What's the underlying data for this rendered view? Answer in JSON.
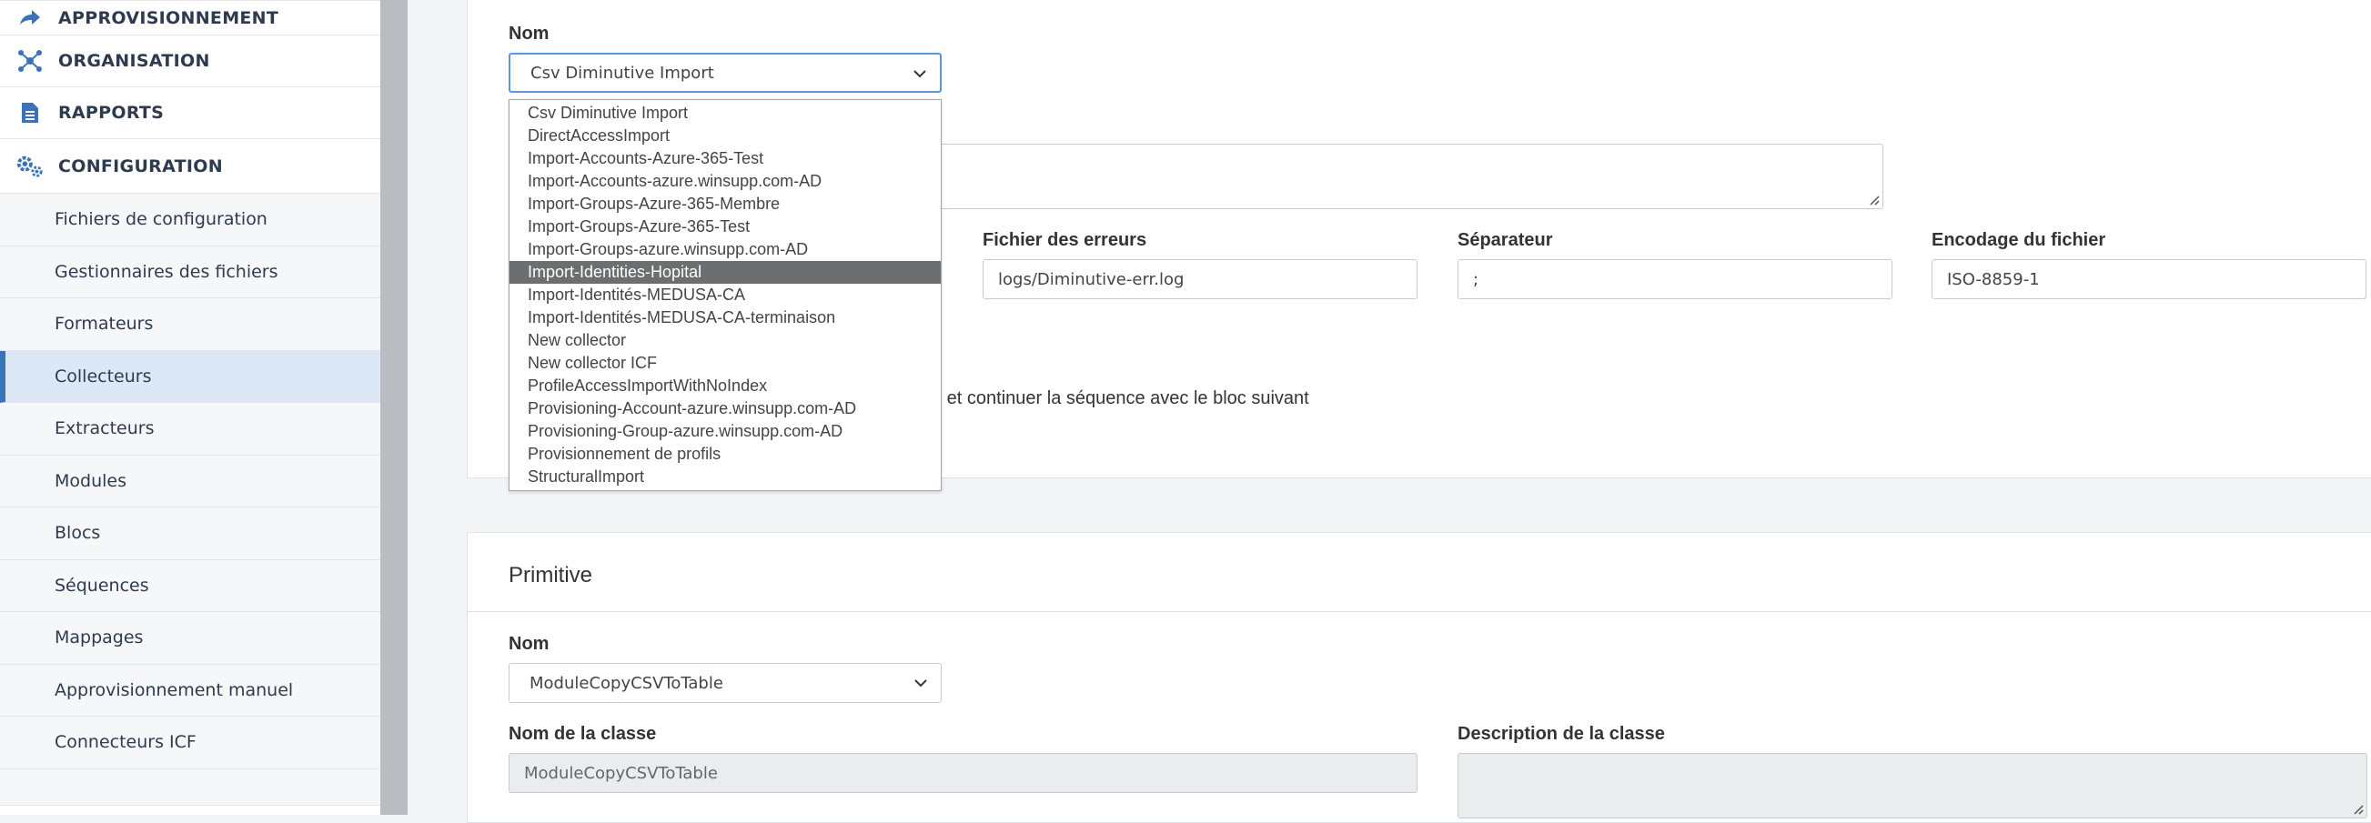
{
  "sidebar": {
    "top_items": [
      {
        "label": "APPROVISIONNEMENT",
        "icon": "share-arrow-icon"
      },
      {
        "label": "ORGANISATION",
        "icon": "network-icon"
      },
      {
        "label": "RAPPORTS",
        "icon": "document-icon"
      },
      {
        "label": "CONFIGURATION",
        "icon": "gears-icon"
      }
    ],
    "sub_items": [
      {
        "label": "Fichiers de configuration",
        "active": false
      },
      {
        "label": "Gestionnaires des fichiers",
        "active": false
      },
      {
        "label": "Formateurs",
        "active": false
      },
      {
        "label": "Collecteurs",
        "active": true
      },
      {
        "label": "Extracteurs",
        "active": false
      },
      {
        "label": "Modules",
        "active": false
      },
      {
        "label": "Blocs",
        "active": false
      },
      {
        "label": "Séquences",
        "active": false
      },
      {
        "label": "Mappages",
        "active": false
      },
      {
        "label": "Approvisionnement manuel",
        "active": false
      },
      {
        "label": "Connecteurs ICF",
        "active": false
      }
    ]
  },
  "collector_form": {
    "name_label": "Nom",
    "name_value": "Csv Diminutive Import",
    "errors_file_label": "Fichier des erreurs",
    "errors_file_value": "logs/Diminutive-err.log",
    "separator_label": "Séparateur",
    "separator_value": ";",
    "encoding_label": "Encodage du fichier",
    "encoding_value": "ISO-8859-1",
    "continue_text": "oc et continuer la séquence avec le bloc suivant"
  },
  "dropdown": {
    "options": [
      "Csv Diminutive Import",
      "DirectAccessImport",
      "Import-Accounts-Azure-365-Test",
      "Import-Accounts-azure.winsupp.com-AD",
      "Import-Groups-Azure-365-Membre",
      "Import-Groups-Azure-365-Test",
      "Import-Groups-azure.winsupp.com-AD",
      "Import-Identities-Hopital",
      "Import-Identités-MEDUSA-CA",
      "Import-Identités-MEDUSA-CA-terminaison",
      "New collector",
      "New collector ICF",
      "ProfileAccessImportWithNoIndex",
      "Provisioning-Account-azure.winsupp.com-AD",
      "Provisioning-Group-azure.winsupp.com-AD",
      "Provisionnement de profils",
      "StructuralImport"
    ],
    "highlighted": "Import-Identities-Hopital"
  },
  "primitive": {
    "title": "Primitive",
    "name_label": "Nom",
    "name_value": "ModuleCopyCSVToTable",
    "class_name_label": "Nom de la classe",
    "class_name_value": "ModuleCopyCSVToTable",
    "class_desc_label": "Description de la classe"
  },
  "colors": {
    "accent": "#3b73b9",
    "active_bg": "#dde8f6",
    "highlight": "#6d6e70",
    "focus_border": "#5a98d8"
  }
}
